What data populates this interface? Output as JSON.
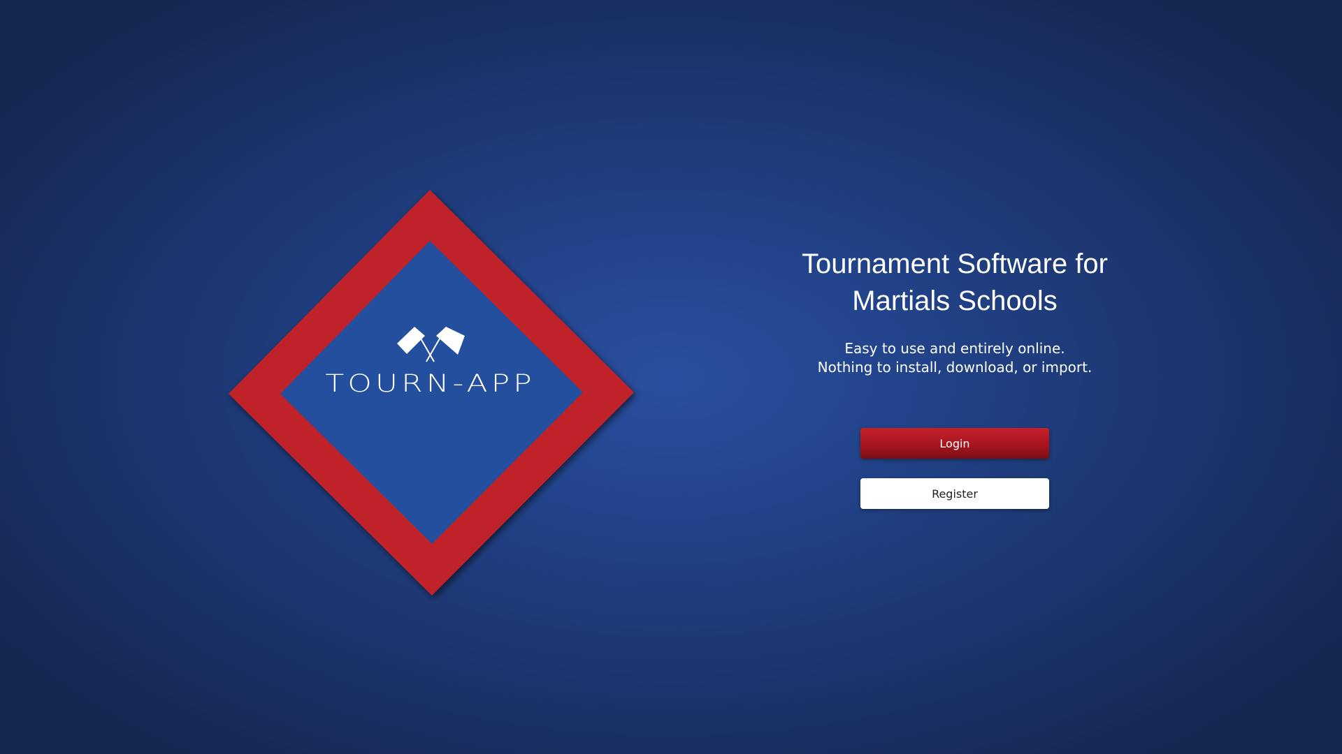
{
  "colors": {
    "background": "#22448c",
    "logo_frame_red": "#c0202a",
    "logo_inner_blue": "#244f9e",
    "login_button": "#b0161f",
    "register_button": "#ffffff"
  },
  "logo": {
    "text": "TOURN-APP",
    "icon": "crossed-flags-icon"
  },
  "hero": {
    "title_line1": "Tournament Software for",
    "title_line2": "Martials Schools",
    "subtitle_line1": "Easy to use and entirely online.",
    "subtitle_line2": "Nothing to install, download, or import."
  },
  "actions": {
    "login_label": "Login",
    "register_label": "Register"
  }
}
